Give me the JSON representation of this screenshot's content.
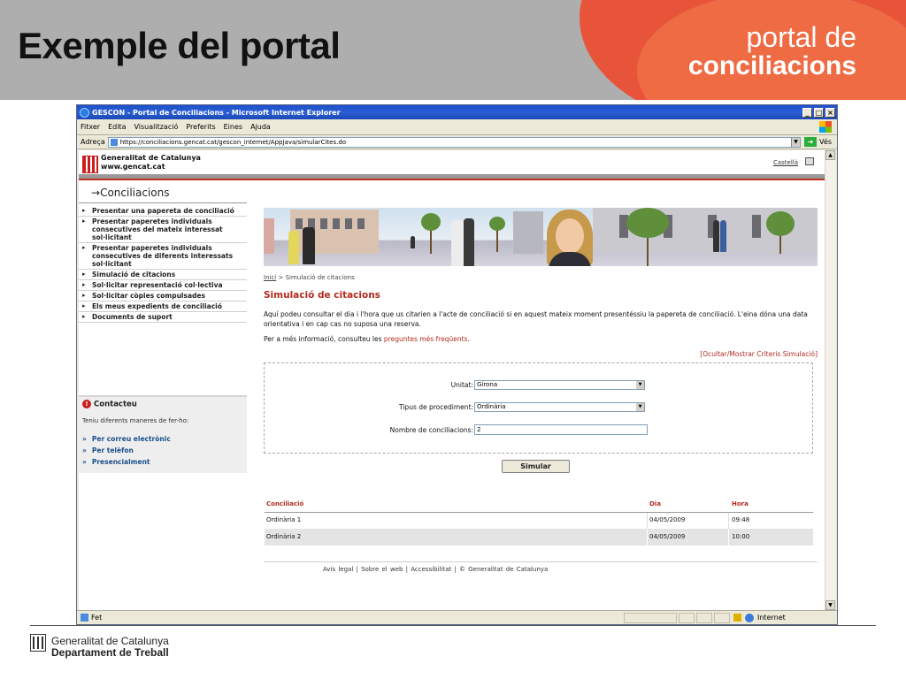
{
  "slide": {
    "title": "Exemple del portal",
    "brand_line1": "portal de",
    "brand_line2": "conciliacions",
    "footer_line1": "Generalitat de Catalunya",
    "footer_line2": "Departament de Treball"
  },
  "browser": {
    "window_title": "GESCON - Portal de Conciliacions - Microsoft Internet Explorer",
    "menu": [
      "Fitxer",
      "Edita",
      "Visualització",
      "Preferits",
      "Eines",
      "Ajuda"
    ],
    "address_label": "Adreça",
    "address_url": "https://conciliacions.gencat.cat/gescon_internet/AppJava/simularCites.do",
    "go_label": "Vés",
    "status_text": "Fet",
    "zone_text": "Internet"
  },
  "page": {
    "gencat_name_line1": "Generalitat de Catalunya",
    "gencat_name_line2": "www.gencat.cat",
    "lang_link": "Castellà",
    "section_title": "Conciliacions",
    "nav": [
      "Presentar una papereta de conciliació",
      "Presentar paperetes individuals consecutives del mateix interessat sol·licitant",
      "Presentar paperetes individuals consecutives de diferents interessats sol·licitant",
      "Simulació de citacions",
      "Sol·licitar representació col·lectiva",
      "Sol·licitar còpies compulsades",
      "Els meus expedients de conciliació",
      "Documents de suport"
    ],
    "contact": {
      "title": "Contacteu",
      "subtitle": "Teniu diferents maneres de fer-ho:",
      "links": [
        "Per correu electrònic",
        "Per telèfon",
        "Presencialment"
      ]
    },
    "breadcrumb_home": "Inici",
    "breadcrumb_current": "> Simulació de citacions",
    "heading": "Simulació de citacions",
    "intro": "Aquí podeu consultar el dia i l'hora que us citarien a l'acte de conciliació si en aquest mateix moment presentéssiu la papereta de conciliació. L'eina dóna una data orientativa i en cap cas no suposa una reserva.",
    "more_info_prefix": "Per a més informació, consulteu les",
    "faq_link": "preguntes més freqüents",
    "more_info_suffix": ".",
    "toggle_link": "[Ocultar/Mostrar Criteris Simulació]",
    "form": {
      "unitat_label": "Unitat:",
      "unitat_value": "Girona",
      "tipus_label": "Tipus de procediment:",
      "tipus_value": "Ordinària",
      "nombre_label": "Nombre de conciliacions:",
      "nombre_value": "2",
      "submit_label": "Simular"
    },
    "results": {
      "headers": [
        "Conciliació",
        "Dia",
        "Hora"
      ],
      "rows": [
        [
          "Ordinària 1",
          "04/05/2009",
          "09:48"
        ],
        [
          "Ordinària 2",
          "04/05/2009",
          "10:00"
        ]
      ]
    },
    "footer_links": "Avís legal | Sobre el web | Accessibilitat | © Generalitat de Catalunya"
  },
  "colors": {
    "brand_orange": "#e7543a",
    "accent_red": "#b22a1e",
    "slide_header_gray": "#aeaeae",
    "xp_titlebar_blue": "#2b5fd6"
  }
}
